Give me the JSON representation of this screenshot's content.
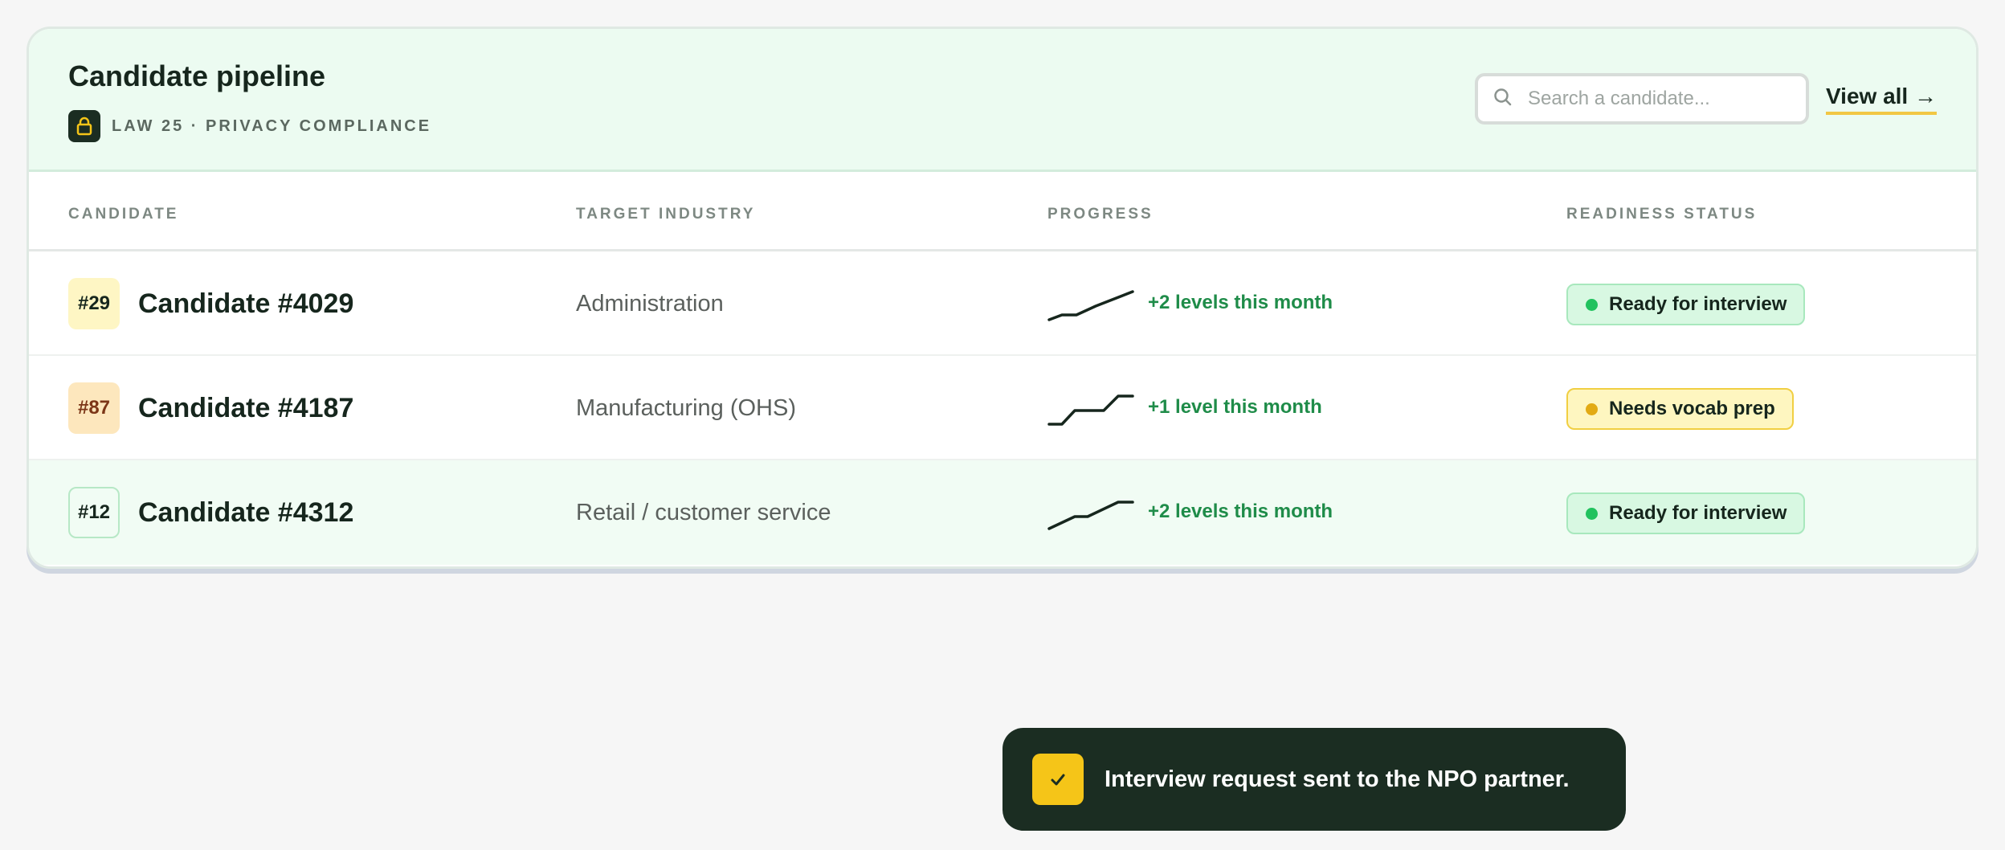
{
  "header": {
    "title": "Candidate pipeline",
    "compliance_label": "LAW 25 · PRIVACY COMPLIANCE",
    "search_placeholder": "Search a candidate...",
    "view_all_label": "View all →"
  },
  "columns": [
    "CANDIDATE",
    "TARGET INDUSTRY",
    "PROGRESS",
    "READINESS STATUS"
  ],
  "rows": [
    {
      "rank": "#29",
      "rank_color": "yellow",
      "name": "Candidate #4029",
      "industry": "Administration",
      "progress": "+2 levels this month",
      "status": "Ready for interview",
      "status_color": "green"
    },
    {
      "rank": "#87",
      "rank_color": "orange",
      "name": "Candidate #4187",
      "industry": "Manufacturing (OHS)",
      "progress": "+1 level this month",
      "status": "Needs vocab prep",
      "status_color": "yellow"
    },
    {
      "rank": "#12",
      "rank_color": "green",
      "name": "Candidate #4312",
      "industry": "Retail / customer service",
      "progress": "+2 levels this month",
      "status": "Ready for interview",
      "status_color": "green"
    }
  ],
  "toast": {
    "message": "Interview request sent to the NPO partner."
  },
  "icons": {
    "compliance": "lock-icon",
    "search": "search-icon",
    "toast": "checkmark-icon"
  },
  "colors": {
    "accent_green": "#1f8c49",
    "accent_yellow": "#f5c518",
    "dark": "#1b2d22"
  }
}
